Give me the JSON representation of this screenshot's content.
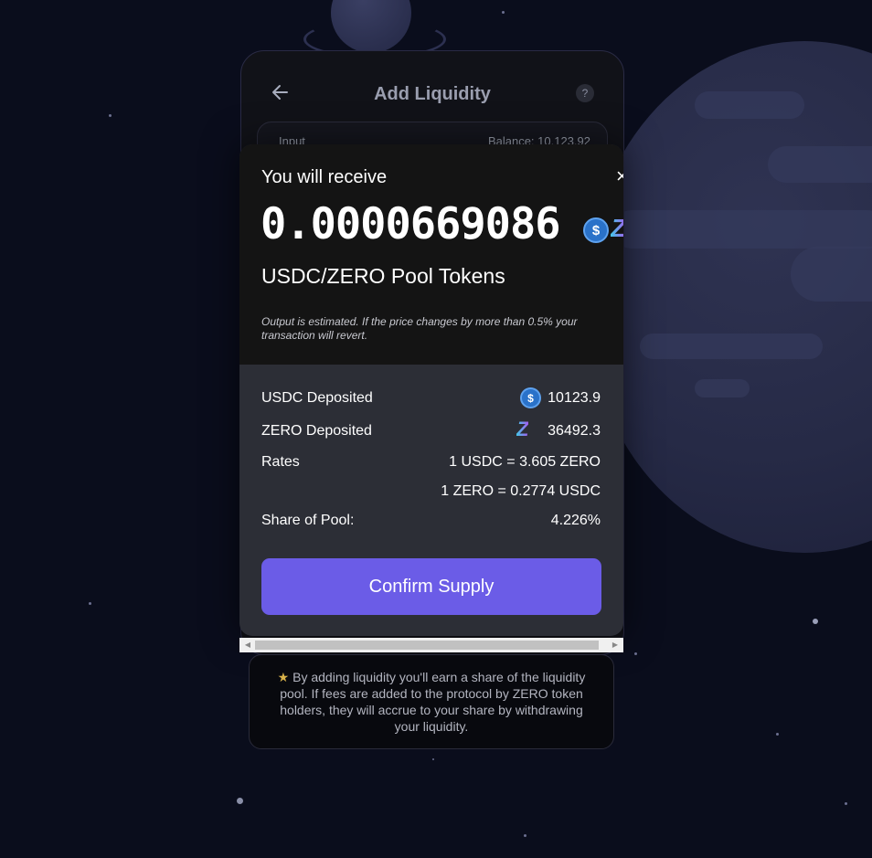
{
  "header": {
    "title": "Add Liquidity",
    "back_icon": "arrow-left-icon",
    "help_icon": "question-circle-icon",
    "help_glyph": "?"
  },
  "input": {
    "label": "Input",
    "balance": "Balance: 10,123.92"
  },
  "modal": {
    "title": "You will receive",
    "close_glyph": "×",
    "amount": "0.0000669086",
    "pool_tokens_label": "USDC/ZERO Pool Tokens",
    "note": "Output is estimated. If the price changes by more than 0.5% your transaction will revert.",
    "usdc_deposited_label": "USDC Deposited",
    "usdc_deposited_value": "10123.9",
    "zero_deposited_label": "ZERO Deposited",
    "zero_deposited_value": "36492.3",
    "rates_label": "Rates",
    "rate_1": "1 USDC = 3.605 ZERO",
    "rate_2": "1 ZERO = 0.2774 USDC",
    "share_label": "Share of Pool:",
    "share_value": "4.226%",
    "confirm_button": "Confirm Supply",
    "usdc_symbol": "$",
    "zero_symbol": "Z"
  },
  "info": {
    "star": "★",
    "text": " By adding liquidity you'll earn a share of the liquidity pool. If fees are added to the protocol by ZERO token holders, they will accrue to your share by withdrawing your liquidity."
  },
  "colors": {
    "background": "#0a0d1c",
    "modal_top": "#141414",
    "modal_body": "#2c2e36",
    "accent": "#6b5ce7",
    "usdc_blue": "#2a72c9"
  }
}
